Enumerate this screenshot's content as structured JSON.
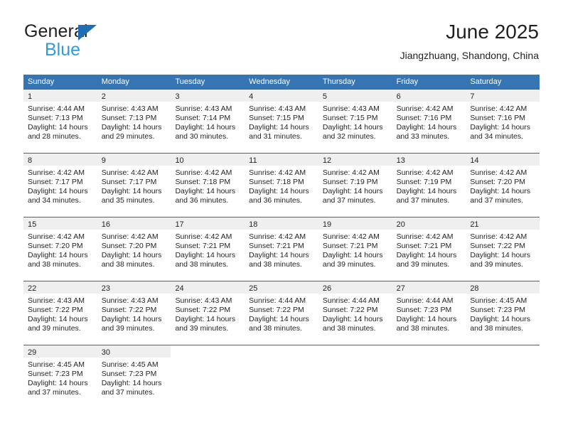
{
  "brand": {
    "name_part1": "General",
    "name_part2": "Blue",
    "triangle_icon": "triangle-icon",
    "primary_color": "#1f6db5",
    "secondary_color": "#2e9ae0"
  },
  "header": {
    "title": "June 2025",
    "subtitle": "Jiangzhuang, Shandong, China"
  },
  "theme": {
    "header_blue": "#3575b4",
    "row_separator": "#2a6ba8",
    "date_band": "#efefef",
    "text": "#231f20"
  },
  "weekdays": [
    "Sunday",
    "Monday",
    "Tuesday",
    "Wednesday",
    "Thursday",
    "Friday",
    "Saturday"
  ],
  "weeks": [
    {
      "days": [
        {
          "date": "1",
          "sunrise": "Sunrise: 4:44 AM",
          "sunset": "Sunset: 7:13 PM",
          "daylight1": "Daylight: 14 hours",
          "daylight2": "and 28 minutes."
        },
        {
          "date": "2",
          "sunrise": "Sunrise: 4:43 AM",
          "sunset": "Sunset: 7:13 PM",
          "daylight1": "Daylight: 14 hours",
          "daylight2": "and 29 minutes."
        },
        {
          "date": "3",
          "sunrise": "Sunrise: 4:43 AM",
          "sunset": "Sunset: 7:14 PM",
          "daylight1": "Daylight: 14 hours",
          "daylight2": "and 30 minutes."
        },
        {
          "date": "4",
          "sunrise": "Sunrise: 4:43 AM",
          "sunset": "Sunset: 7:15 PM",
          "daylight1": "Daylight: 14 hours",
          "daylight2": "and 31 minutes."
        },
        {
          "date": "5",
          "sunrise": "Sunrise: 4:43 AM",
          "sunset": "Sunset: 7:15 PM",
          "daylight1": "Daylight: 14 hours",
          "daylight2": "and 32 minutes."
        },
        {
          "date": "6",
          "sunrise": "Sunrise: 4:42 AM",
          "sunset": "Sunset: 7:16 PM",
          "daylight1": "Daylight: 14 hours",
          "daylight2": "and 33 minutes."
        },
        {
          "date": "7",
          "sunrise": "Sunrise: 4:42 AM",
          "sunset": "Sunset: 7:16 PM",
          "daylight1": "Daylight: 14 hours",
          "daylight2": "and 34 minutes."
        }
      ]
    },
    {
      "days": [
        {
          "date": "8",
          "sunrise": "Sunrise: 4:42 AM",
          "sunset": "Sunset: 7:17 PM",
          "daylight1": "Daylight: 14 hours",
          "daylight2": "and 34 minutes."
        },
        {
          "date": "9",
          "sunrise": "Sunrise: 4:42 AM",
          "sunset": "Sunset: 7:17 PM",
          "daylight1": "Daylight: 14 hours",
          "daylight2": "and 35 minutes."
        },
        {
          "date": "10",
          "sunrise": "Sunrise: 4:42 AM",
          "sunset": "Sunset: 7:18 PM",
          "daylight1": "Daylight: 14 hours",
          "daylight2": "and 36 minutes."
        },
        {
          "date": "11",
          "sunrise": "Sunrise: 4:42 AM",
          "sunset": "Sunset: 7:18 PM",
          "daylight1": "Daylight: 14 hours",
          "daylight2": "and 36 minutes."
        },
        {
          "date": "12",
          "sunrise": "Sunrise: 4:42 AM",
          "sunset": "Sunset: 7:19 PM",
          "daylight1": "Daylight: 14 hours",
          "daylight2": "and 37 minutes."
        },
        {
          "date": "13",
          "sunrise": "Sunrise: 4:42 AM",
          "sunset": "Sunset: 7:19 PM",
          "daylight1": "Daylight: 14 hours",
          "daylight2": "and 37 minutes."
        },
        {
          "date": "14",
          "sunrise": "Sunrise: 4:42 AM",
          "sunset": "Sunset: 7:20 PM",
          "daylight1": "Daylight: 14 hours",
          "daylight2": "and 37 minutes."
        }
      ]
    },
    {
      "days": [
        {
          "date": "15",
          "sunrise": "Sunrise: 4:42 AM",
          "sunset": "Sunset: 7:20 PM",
          "daylight1": "Daylight: 14 hours",
          "daylight2": "and 38 minutes."
        },
        {
          "date": "16",
          "sunrise": "Sunrise: 4:42 AM",
          "sunset": "Sunset: 7:20 PM",
          "daylight1": "Daylight: 14 hours",
          "daylight2": "and 38 minutes."
        },
        {
          "date": "17",
          "sunrise": "Sunrise: 4:42 AM",
          "sunset": "Sunset: 7:21 PM",
          "daylight1": "Daylight: 14 hours",
          "daylight2": "and 38 minutes."
        },
        {
          "date": "18",
          "sunrise": "Sunrise: 4:42 AM",
          "sunset": "Sunset: 7:21 PM",
          "daylight1": "Daylight: 14 hours",
          "daylight2": "and 38 minutes."
        },
        {
          "date": "19",
          "sunrise": "Sunrise: 4:42 AM",
          "sunset": "Sunset: 7:21 PM",
          "daylight1": "Daylight: 14 hours",
          "daylight2": "and 39 minutes."
        },
        {
          "date": "20",
          "sunrise": "Sunrise: 4:42 AM",
          "sunset": "Sunset: 7:21 PM",
          "daylight1": "Daylight: 14 hours",
          "daylight2": "and 39 minutes."
        },
        {
          "date": "21",
          "sunrise": "Sunrise: 4:42 AM",
          "sunset": "Sunset: 7:22 PM",
          "daylight1": "Daylight: 14 hours",
          "daylight2": "and 39 minutes."
        }
      ]
    },
    {
      "days": [
        {
          "date": "22",
          "sunrise": "Sunrise: 4:43 AM",
          "sunset": "Sunset: 7:22 PM",
          "daylight1": "Daylight: 14 hours",
          "daylight2": "and 39 minutes."
        },
        {
          "date": "23",
          "sunrise": "Sunrise: 4:43 AM",
          "sunset": "Sunset: 7:22 PM",
          "daylight1": "Daylight: 14 hours",
          "daylight2": "and 39 minutes."
        },
        {
          "date": "24",
          "sunrise": "Sunrise: 4:43 AM",
          "sunset": "Sunset: 7:22 PM",
          "daylight1": "Daylight: 14 hours",
          "daylight2": "and 39 minutes."
        },
        {
          "date": "25",
          "sunrise": "Sunrise: 4:44 AM",
          "sunset": "Sunset: 7:22 PM",
          "daylight1": "Daylight: 14 hours",
          "daylight2": "and 38 minutes."
        },
        {
          "date": "26",
          "sunrise": "Sunrise: 4:44 AM",
          "sunset": "Sunset: 7:22 PM",
          "daylight1": "Daylight: 14 hours",
          "daylight2": "and 38 minutes."
        },
        {
          "date": "27",
          "sunrise": "Sunrise: 4:44 AM",
          "sunset": "Sunset: 7:23 PM",
          "daylight1": "Daylight: 14 hours",
          "daylight2": "and 38 minutes."
        },
        {
          "date": "28",
          "sunrise": "Sunrise: 4:45 AM",
          "sunset": "Sunset: 7:23 PM",
          "daylight1": "Daylight: 14 hours",
          "daylight2": "and 38 minutes."
        }
      ]
    },
    {
      "days": [
        {
          "date": "29",
          "sunrise": "Sunrise: 4:45 AM",
          "sunset": "Sunset: 7:23 PM",
          "daylight1": "Daylight: 14 hours",
          "daylight2": "and 37 minutes."
        },
        {
          "date": "30",
          "sunrise": "Sunrise: 4:45 AM",
          "sunset": "Sunset: 7:23 PM",
          "daylight1": "Daylight: 14 hours",
          "daylight2": "and 37 minutes."
        },
        {
          "date": "",
          "sunrise": "",
          "sunset": "",
          "daylight1": "",
          "daylight2": ""
        },
        {
          "date": "",
          "sunrise": "",
          "sunset": "",
          "daylight1": "",
          "daylight2": ""
        },
        {
          "date": "",
          "sunrise": "",
          "sunset": "",
          "daylight1": "",
          "daylight2": ""
        },
        {
          "date": "",
          "sunrise": "",
          "sunset": "",
          "daylight1": "",
          "daylight2": ""
        },
        {
          "date": "",
          "sunrise": "",
          "sunset": "",
          "daylight1": "",
          "daylight2": ""
        }
      ]
    }
  ]
}
